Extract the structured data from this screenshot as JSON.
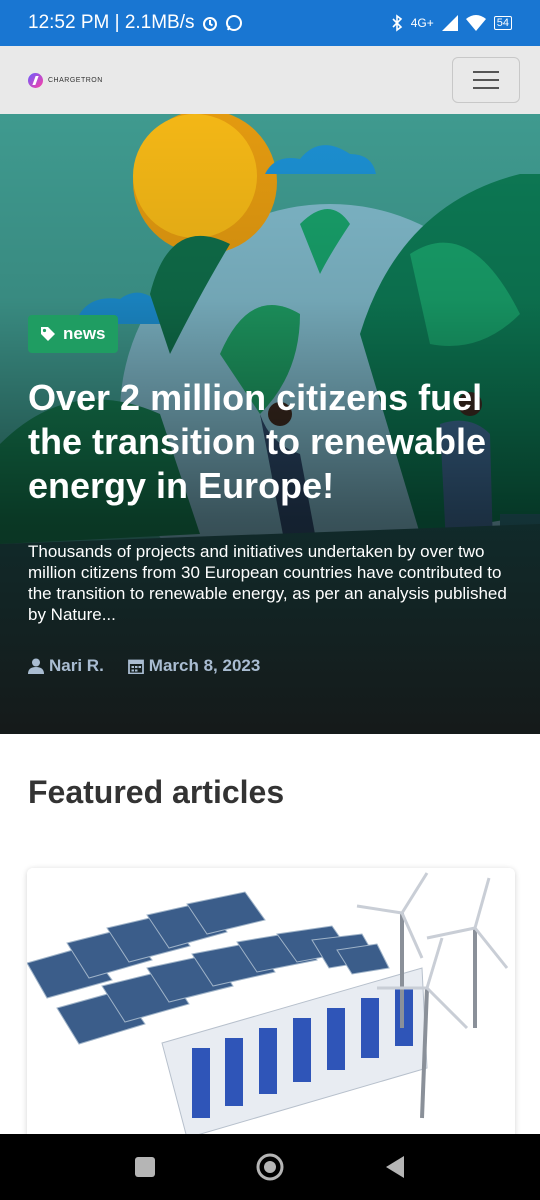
{
  "status": {
    "time_speed": "12:52 PM | 2.1MB/s",
    "network": "4G+",
    "battery": "54"
  },
  "navbar": {
    "logo_text": "CHARGETRON"
  },
  "hero": {
    "badge": "news",
    "title": "Over 2 million citizens fuel the transition to renewable energy in Europe!",
    "excerpt": "Thousands of projects and initiatives undertaken by over two million citizens from 30 European countries have contributed to the transition to renewable energy, as per an analysis published by Nature...",
    "author": "Nari R.",
    "date": "March 8, 2023"
  },
  "featured": {
    "title": "Featured articles"
  },
  "colors": {
    "status_bar": "#1976d2",
    "badge": "#1f9d62",
    "meta": "#a9bcd1"
  }
}
